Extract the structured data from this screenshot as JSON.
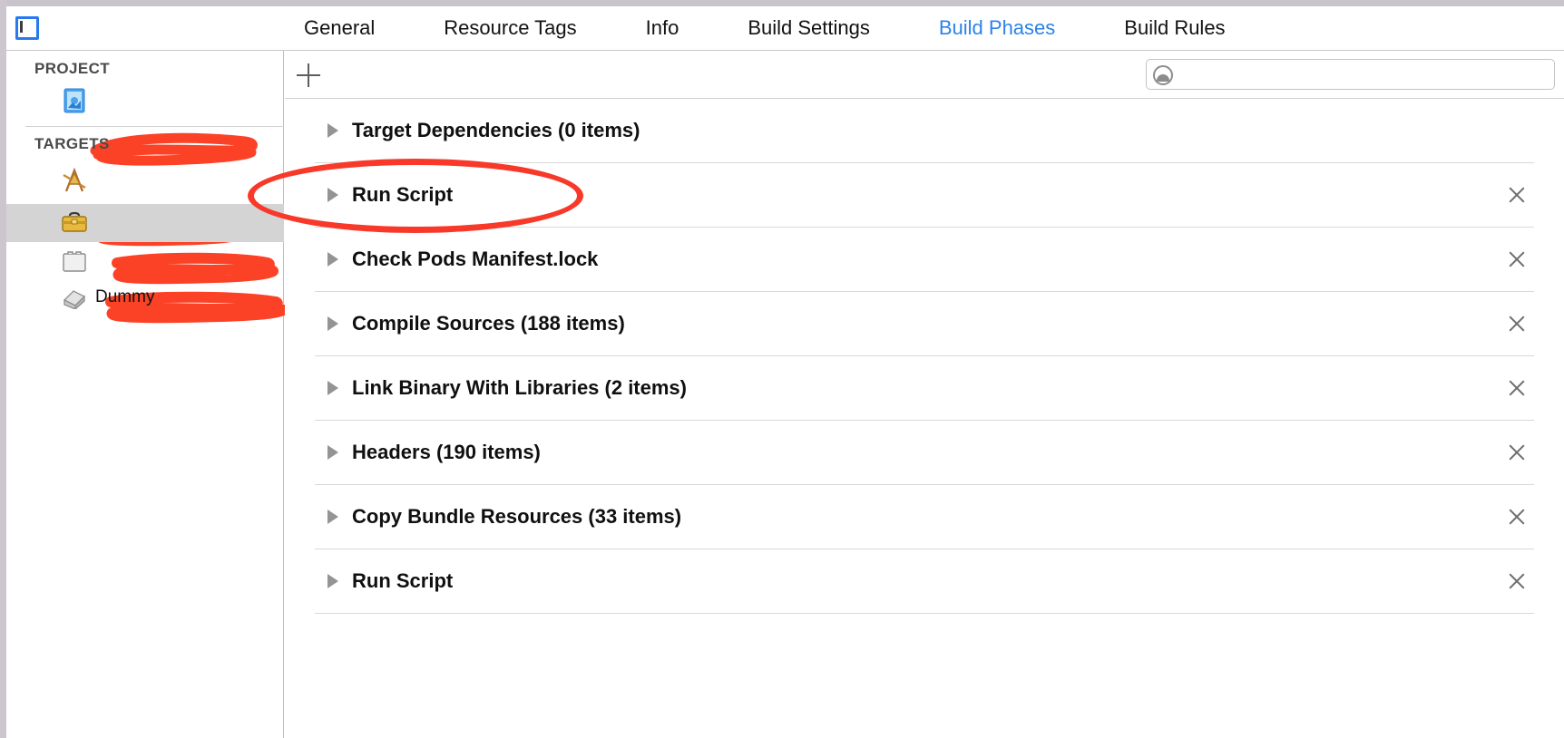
{
  "window": {
    "tab_icon": "editor-panel-icon"
  },
  "tabbar": {
    "tabs": [
      {
        "label": "General",
        "active": false
      },
      {
        "label": "Resource Tags",
        "active": false
      },
      {
        "label": "Info",
        "active": false
      },
      {
        "label": "Build Settings",
        "active": false
      },
      {
        "label": "Build Phases",
        "active": true
      },
      {
        "label": "Build Rules",
        "active": false
      }
    ],
    "active_color": "#2b83e8",
    "inactive_color": "#121212"
  },
  "sidebar": {
    "project_header": "PROJECT",
    "targets_header": "TARGETS",
    "project_items": [
      {
        "label": "",
        "icon": "xcode-project-icon",
        "redacted": true
      }
    ],
    "target_items": [
      {
        "label": "",
        "icon": "app-target-icon",
        "redacted": true,
        "selected": false
      },
      {
        "label": "",
        "icon": "toolbox-target-icon",
        "redacted": true,
        "selected": true
      },
      {
        "label": "",
        "icon": "bundle-target-icon",
        "redacted": true,
        "selected": false
      },
      {
        "label": "Dummy",
        "icon": "aggregate-target-icon",
        "redacted": false,
        "selected": false
      }
    ]
  },
  "detail": {
    "add_button": "+",
    "search": {
      "value": "",
      "placeholder": "",
      "icon": "search-filter-icon"
    },
    "phases": [
      {
        "title": "Target Dependencies (0 items)",
        "removable": false,
        "annotated": false
      },
      {
        "title": "Run Script",
        "removable": true,
        "annotated": true
      },
      {
        "title": "Check Pods Manifest.lock",
        "removable": true,
        "annotated": false
      },
      {
        "title": "Compile Sources (188 items)",
        "removable": true,
        "annotated": false
      },
      {
        "title": "Link Binary With Libraries (2 items)",
        "removable": true,
        "annotated": false
      },
      {
        "title": "Headers (190 items)",
        "removable": true,
        "annotated": false
      },
      {
        "title": "Copy Bundle Resources (33 items)",
        "removable": true,
        "annotated": false
      },
      {
        "title": "Run Script",
        "removable": true,
        "annotated": false
      }
    ]
  },
  "annotations": {
    "redaction_color": "#fc4226",
    "highlight_color": "#f8392a",
    "highlight_target": "Run Script"
  }
}
